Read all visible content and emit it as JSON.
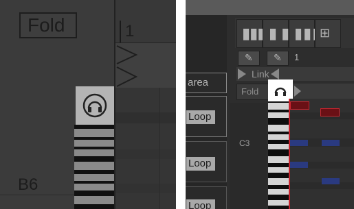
{
  "left": {
    "fold_label": "Fold",
    "bar_number": "1",
    "note_label": "B6",
    "preview_icon": "headphones-icon"
  },
  "right": {
    "link_label": "Link",
    "area_label": "area",
    "fold_label": "Fold",
    "bar_number": "1",
    "note_label": "C3",
    "loop_labels": [
      "Loop",
      "Loop",
      "Loop"
    ],
    "preview_icon": "headphones-icon",
    "edit_icons": [
      "pencil-icon",
      "pencil-icon"
    ],
    "grid_icons": [
      "grid-4-icon",
      "grid-2-icon",
      "grid-3-icon",
      "grid-dense-icon"
    ]
  },
  "colors": {
    "accent_red": "#c8242e",
    "note_blue": "#2a3a80",
    "selection_white": "#ffffff"
  }
}
